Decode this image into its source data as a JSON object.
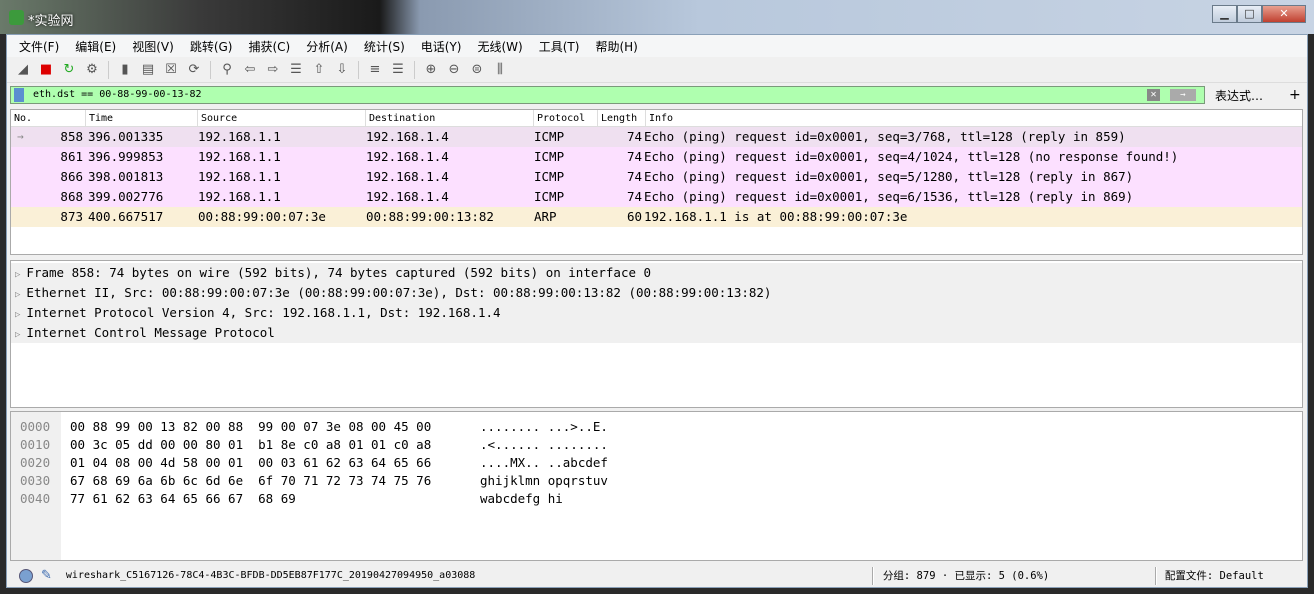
{
  "window": {
    "title": "*实验网",
    "min": "▁",
    "max": "□",
    "close": "✕"
  },
  "menu": [
    "文件(F)",
    "编辑(E)",
    "视图(V)",
    "跳转(G)",
    "捕获(C)",
    "分析(A)",
    "统计(S)",
    "电话(Y)",
    "无线(W)",
    "工具(T)",
    "帮助(H)"
  ],
  "toolbar": [
    {
      "n": "shark-fin-start",
      "g": "◢"
    },
    {
      "n": "stop",
      "g": "■"
    },
    {
      "n": "restart",
      "g": "↻"
    },
    {
      "n": "options",
      "g": "⚙"
    },
    {
      "n": "open",
      "g": "▮"
    },
    {
      "n": "save",
      "g": "▤"
    },
    {
      "n": "close-file",
      "g": "☒"
    },
    {
      "n": "reload",
      "g": "⟳"
    },
    {
      "n": "find",
      "g": "⚲"
    },
    {
      "n": "back",
      "g": "⇦"
    },
    {
      "n": "forward",
      "g": "⇨"
    },
    {
      "n": "goto",
      "g": "☰"
    },
    {
      "n": "first",
      "g": "⇧"
    },
    {
      "n": "last",
      "g": "⇩"
    },
    {
      "n": "autoscroll",
      "g": "≡"
    },
    {
      "n": "colorize",
      "g": "☰"
    },
    {
      "n": "zoom-in",
      "g": "⊕"
    },
    {
      "n": "zoom-out",
      "g": "⊖"
    },
    {
      "n": "zoom-reset",
      "g": "⊜"
    },
    {
      "n": "resize-columns",
      "g": "⫼"
    }
  ],
  "filter": {
    "value": "eth.dst == 00-88-99-00-13-82",
    "expression": "表达式…",
    "plus": "+",
    "clear": "✕",
    "apply": "→"
  },
  "columns": [
    "No.",
    "Time",
    "Source",
    "Destination",
    "Protocol",
    "Length",
    "Info"
  ],
  "packets": [
    {
      "no": "858",
      "time": "396.001335",
      "src": "192.168.1.1",
      "dst": "192.168.1.4",
      "proto": "ICMP",
      "len": "74",
      "info": "Echo (ping) request  id=0x0001, seq=3/768, ttl=128 (reply in 859)",
      "bg": "#efe0f0",
      "sel": true
    },
    {
      "no": "861",
      "time": "396.999853",
      "src": "192.168.1.1",
      "dst": "192.168.1.4",
      "proto": "ICMP",
      "len": "74",
      "info": "Echo (ping) request  id=0x0001, seq=4/1024, ttl=128 (no response found!)",
      "bg": "#fce0ff"
    },
    {
      "no": "866",
      "time": "398.001813",
      "src": "192.168.1.1",
      "dst": "192.168.1.4",
      "proto": "ICMP",
      "len": "74",
      "info": "Echo (ping) request  id=0x0001, seq=5/1280, ttl=128 (reply in 867)",
      "bg": "#fce0ff"
    },
    {
      "no": "868",
      "time": "399.002776",
      "src": "192.168.1.1",
      "dst": "192.168.1.4",
      "proto": "ICMP",
      "len": "74",
      "info": "Echo (ping) request  id=0x0001, seq=6/1536, ttl=128 (reply in 869)",
      "bg": "#fce0ff"
    },
    {
      "no": "873",
      "time": "400.667517",
      "src": "00:88:99:00:07:3e",
      "dst": "00:88:99:00:13:82",
      "proto": "ARP",
      "len": "60",
      "info": "192.168.1.1 is at 00:88:99:00:07:3e",
      "bg": "#faf0d7"
    }
  ],
  "details": [
    "Frame 858: 74 bytes on wire (592 bits), 74 bytes captured (592 bits) on interface 0",
    "Ethernet II, Src: 00:88:99:00:07:3e (00:88:99:00:07:3e), Dst: 00:88:99:00:13:82 (00:88:99:00:13:82)",
    "Internet Protocol Version 4, Src: 192.168.1.1, Dst: 192.168.1.4",
    "Internet Control Message Protocol"
  ],
  "hex": [
    {
      "off": "0000",
      "bytes": "00 88 99 00 13 82 00 88  99 00 07 3e 08 00 45 00",
      "ascii": "........ ...>..E."
    },
    {
      "off": "0010",
      "bytes": "00 3c 05 dd 00 00 80 01  b1 8e c0 a8 01 01 c0 a8",
      "ascii": ".<...... ........"
    },
    {
      "off": "0020",
      "bytes": "01 04 08 00 4d 58 00 01  00 03 61 62 63 64 65 66",
      "ascii": "....MX.. ..abcdef"
    },
    {
      "off": "0030",
      "bytes": "67 68 69 6a 6b 6c 6d 6e  6f 70 71 72 73 74 75 76",
      "ascii": "ghijklmn opqrstuv"
    },
    {
      "off": "0040",
      "bytes": "77 61 62 63 64 65 66 67  68 69",
      "ascii": "wabcdefg hi"
    }
  ],
  "status": {
    "file": "wireshark_C5167126-78C4-4B3C-BFDB-DD5EB87F177C_20190427094950_a03088",
    "counts": "分组: 879 · 已显示: 5 (0.6%)",
    "profile": "配置文件: Default"
  }
}
